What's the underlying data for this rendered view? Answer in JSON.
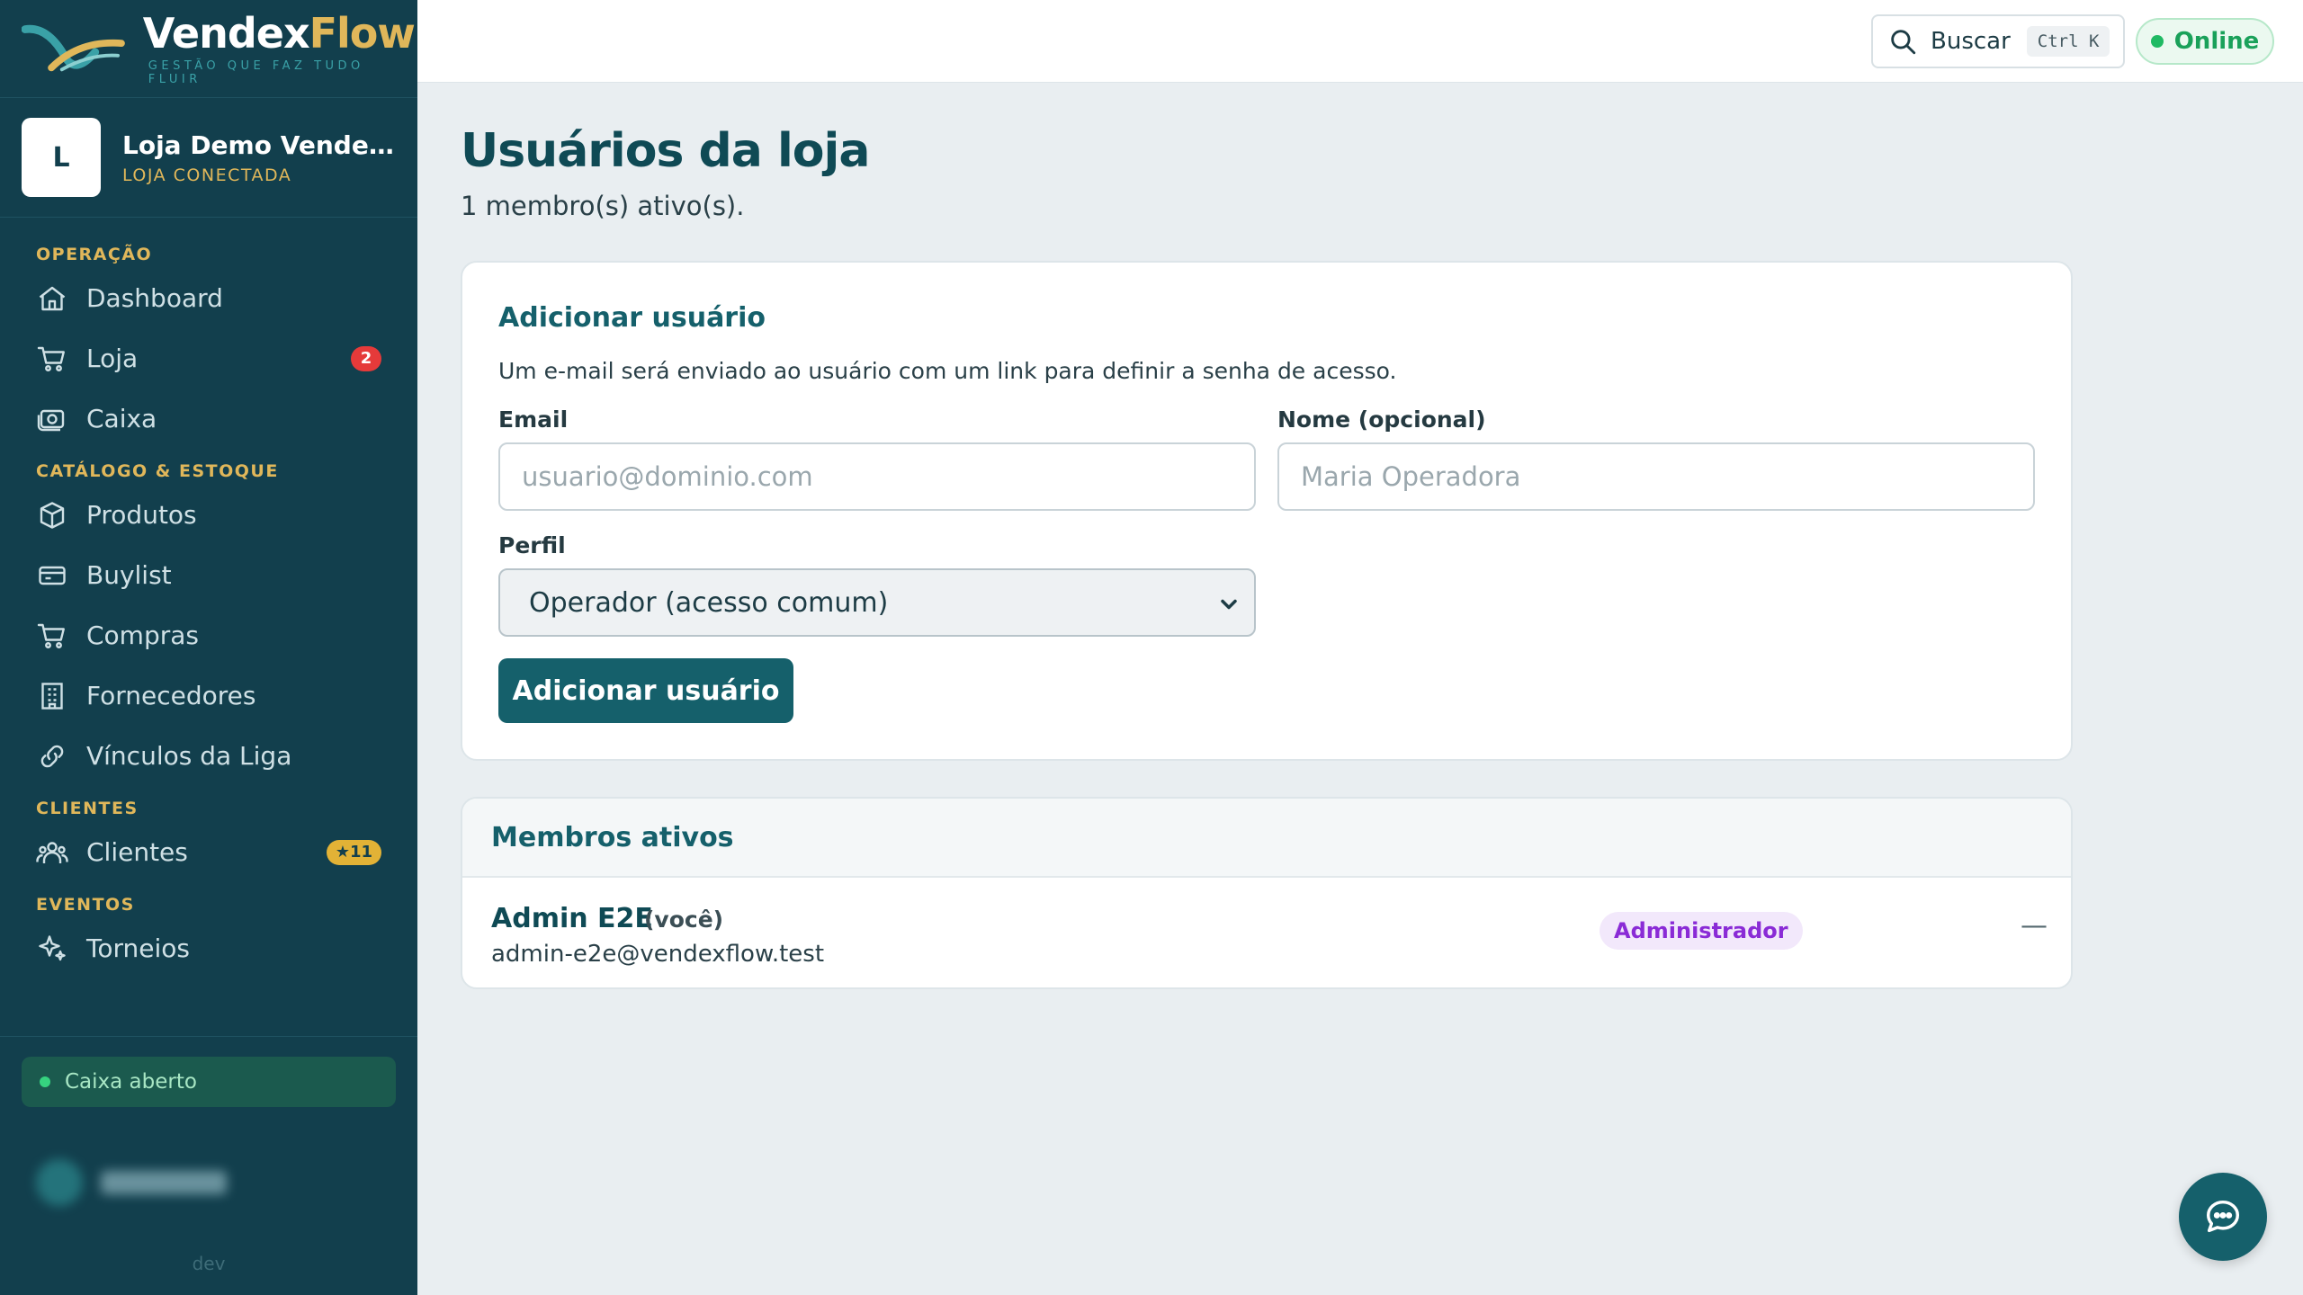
{
  "brand": {
    "name_part1": "Vendex",
    "name_part2": "Flow",
    "tagline": "GESTÃO QUE FAZ TUDO FLUIR"
  },
  "store": {
    "avatar_letter": "L",
    "name": "Loja Demo VendexFl...",
    "status": "LOJA CONECTADA"
  },
  "nav": {
    "sections": [
      {
        "label": "OPERAÇÃO"
      },
      {
        "label": "CATÁLOGO & ESTOQUE"
      },
      {
        "label": "CLIENTES"
      },
      {
        "label": "EVENTOS"
      }
    ],
    "items": [
      {
        "label": "Dashboard",
        "icon": "home-icon"
      },
      {
        "label": "Loja",
        "icon": "cart-icon",
        "badge": "2"
      },
      {
        "label": "Caixa",
        "icon": "cash-register-icon"
      },
      {
        "label": "Produtos",
        "icon": "box-icon"
      },
      {
        "label": "Buylist",
        "icon": "card-icon"
      },
      {
        "label": "Compras",
        "icon": "cart-icon"
      },
      {
        "label": "Fornecedores",
        "icon": "building-icon"
      },
      {
        "label": "Vínculos da Liga",
        "icon": "link-icon"
      },
      {
        "label": "Clientes",
        "icon": "users-icon",
        "badge": "★11"
      },
      {
        "label": "Torneios",
        "icon": "sparkle-icon"
      }
    ]
  },
  "sidebar_footer": {
    "cash_status": "Caixa aberto",
    "env": "dev"
  },
  "topbar": {
    "search_label": "Buscar",
    "shortcut": "Ctrl K",
    "connection": "Online"
  },
  "page": {
    "title": "Usuários da loja",
    "subtitle": "1 membro(s) ativo(s)."
  },
  "add_user": {
    "title": "Adicionar usuário",
    "description": "Um e-mail será enviado ao usuário com um link para definir a senha de acesso.",
    "email_label": "Email",
    "email_placeholder": "usuario@dominio.com",
    "name_label": "Nome (opcional)",
    "name_placeholder": "Maria Operadora",
    "profile_label": "Perfil",
    "profile_value": "Operador (acesso comum)",
    "submit_label": "Adicionar usuário"
  },
  "members": {
    "title": "Membros ativos",
    "rows": [
      {
        "name": "Admin E2E",
        "you": "(você)",
        "email": "admin-e2e@vendexflow.test",
        "role": "Administrador",
        "action": "—"
      }
    ]
  },
  "colors": {
    "sidebar": "#123f4d",
    "accent": "#15606b",
    "gold": "#e0b75a",
    "online": "#1aa15a"
  }
}
